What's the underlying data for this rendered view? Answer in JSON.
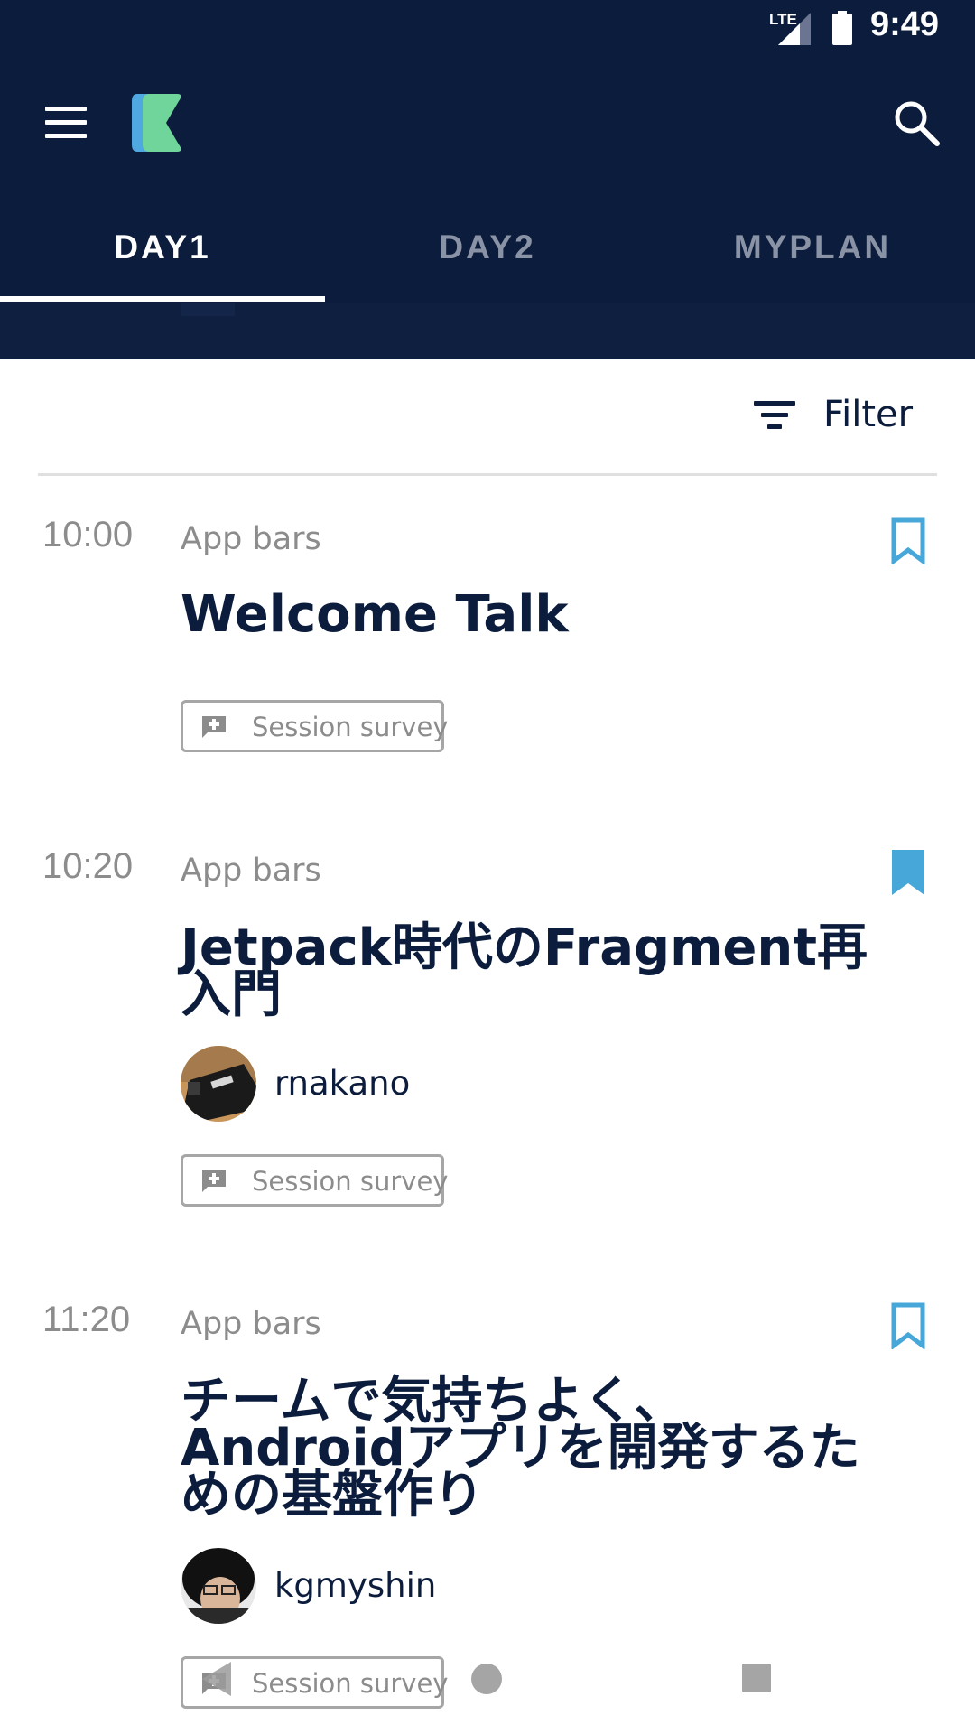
{
  "status_bar": {
    "network": "LTE",
    "time": "9:49"
  },
  "app_bar": {
    "menu_icon": "menu-icon",
    "logo_icon": "app-logo-icon",
    "search_icon": "search-icon"
  },
  "tabs": [
    {
      "label": "DAY1",
      "selected": true
    },
    {
      "label": "DAY2",
      "selected": false
    },
    {
      "label": "MYPLAN",
      "selected": false
    }
  ],
  "filter": {
    "label": "Filter",
    "icon": "filter-icon"
  },
  "sessions": [
    {
      "time": "10:00",
      "room": "App bars",
      "title": "Welcome Talk",
      "bookmarked": false,
      "survey_label": "Session survey"
    },
    {
      "time": "10:20",
      "room": "App bars",
      "title": "Jetpack時代のFragment再入門",
      "bookmarked": true,
      "speaker": "rnakano",
      "survey_label": "Session survey"
    },
    {
      "time": "11:20",
      "room": "App bars",
      "title": "チームで気持ちよく、Androidアプリを開発するための基盤作り",
      "bookmarked": false,
      "speaker": "kgmyshin",
      "survey_label": "Session survey"
    }
  ],
  "colors": {
    "primary": "#0c1c3c",
    "accent": "#46a7d8",
    "inactive_tab": "#8a93a5",
    "muted_text": "#8c8c8c"
  }
}
